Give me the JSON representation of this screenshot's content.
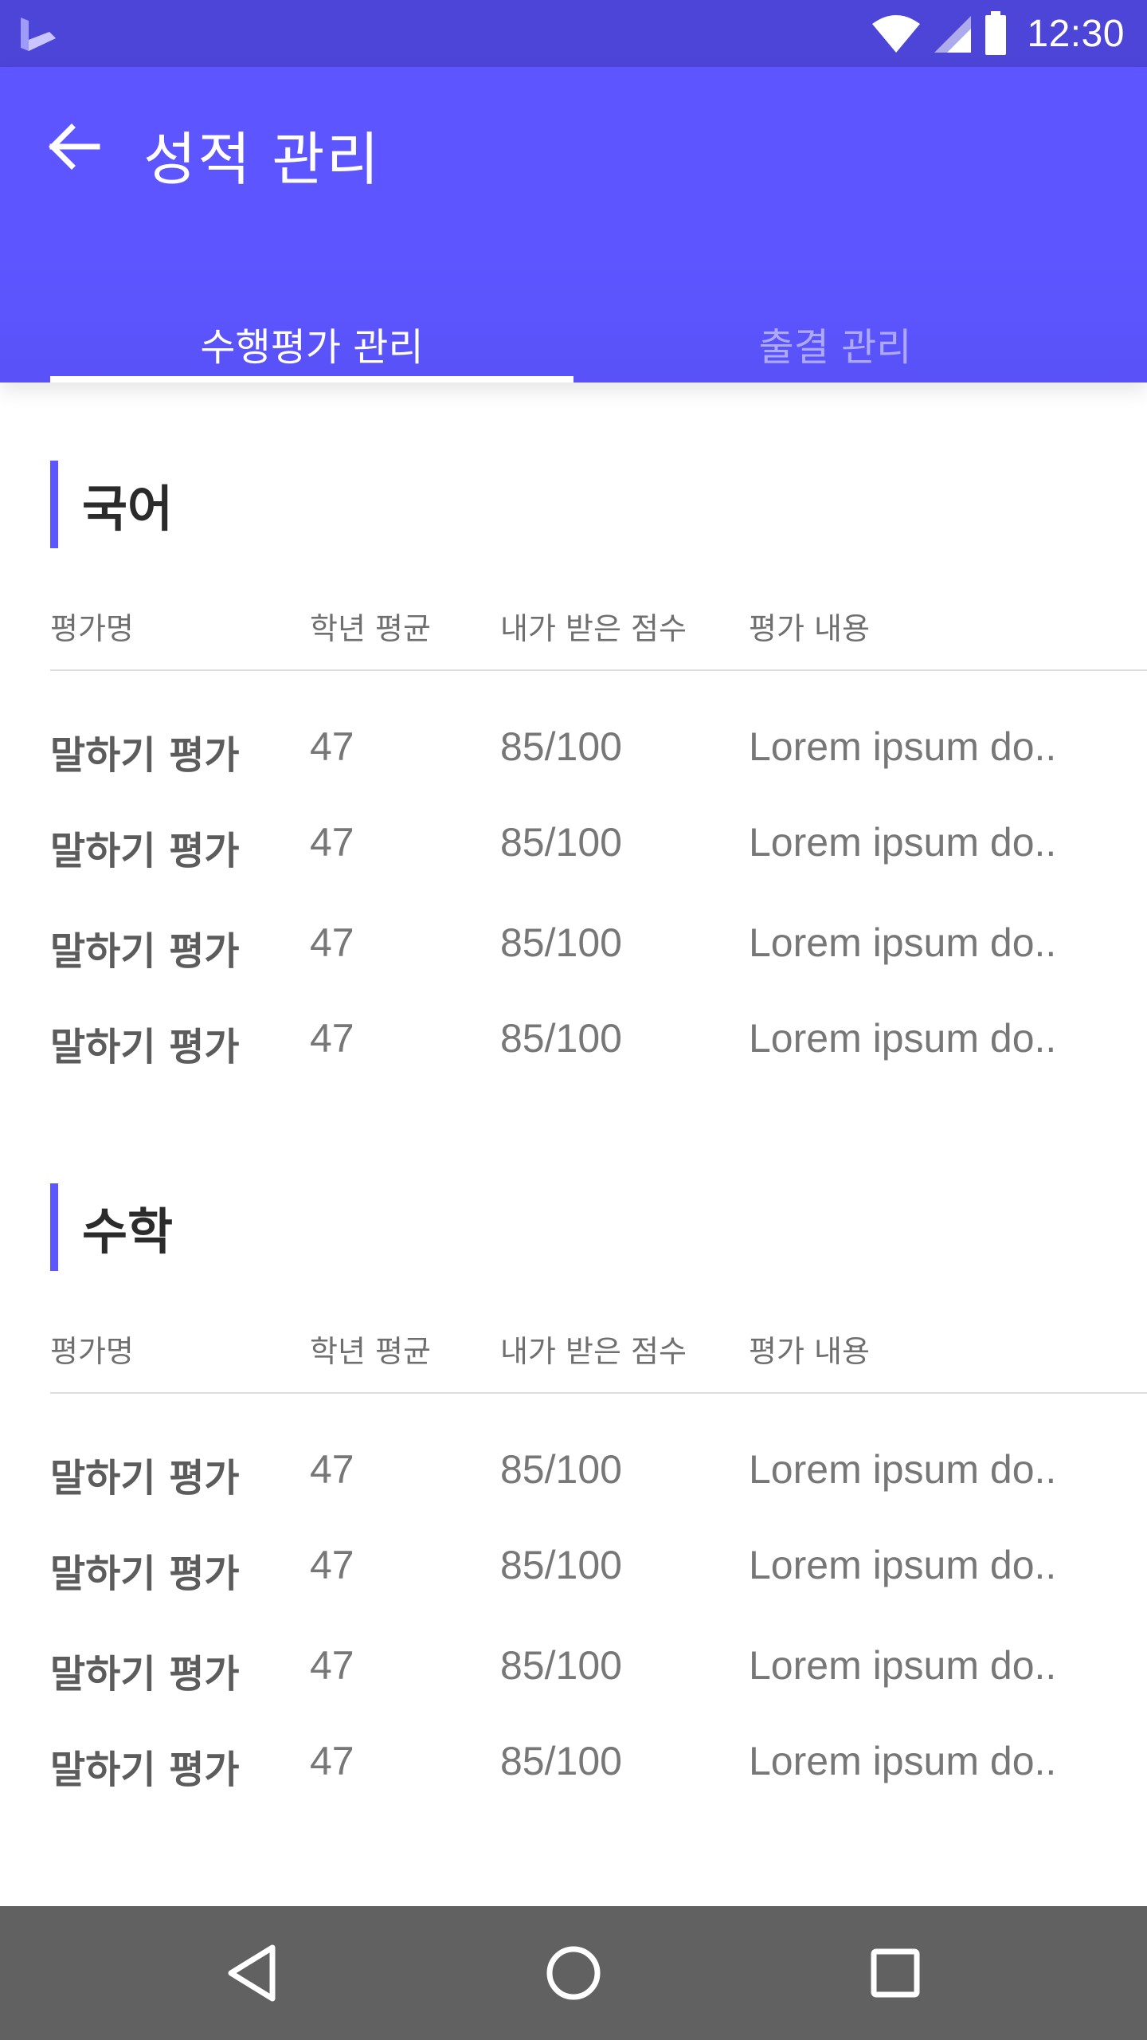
{
  "status_bar": {
    "time": "12:30",
    "icons": [
      "wifi-icon",
      "signal-icon",
      "battery-icon"
    ]
  },
  "app_bar": {
    "title": "성적 관리",
    "back_icon": "arrow-back-icon"
  },
  "tabs": [
    {
      "label": "수행평가 관리",
      "active": true
    },
    {
      "label": "출결 관리",
      "active": false
    }
  ],
  "columns": {
    "name": "평가명",
    "grade_avg": "학년 평균",
    "my_score": "내가 받은 점수",
    "content": "평가 내용"
  },
  "sections": [
    {
      "title": "국어",
      "rows": [
        {
          "name": "말하기 평가",
          "avg": "47",
          "score": "85/100",
          "content": "Lorem ipsum do.."
        },
        {
          "name": "말하기 평가",
          "avg": "47",
          "score": "85/100",
          "content": "Lorem ipsum do.."
        },
        {
          "name": "말하기 평가",
          "avg": "47",
          "score": "85/100",
          "content": "Lorem ipsum do.."
        },
        {
          "name": "말하기 평가",
          "avg": "47",
          "score": "85/100",
          "content": "Lorem ipsum do.."
        }
      ]
    },
    {
      "title": "수학",
      "rows": [
        {
          "name": "말하기 평가",
          "avg": "47",
          "score": "85/100",
          "content": "Lorem ipsum do.."
        },
        {
          "name": "말하기 평가",
          "avg": "47",
          "score": "85/100",
          "content": "Lorem ipsum do.."
        },
        {
          "name": "말하기 평가",
          "avg": "47",
          "score": "85/100",
          "content": "Lorem ipsum do.."
        },
        {
          "name": "말하기 평가",
          "avg": "47",
          "score": "85/100",
          "content": "Lorem ipsum do.."
        }
      ]
    }
  ],
  "nav_bar": {
    "icons": [
      "back-triangle-icon",
      "home-circle-icon",
      "recents-square-icon"
    ]
  },
  "colors": {
    "status_bar": "#4c45d8",
    "primary": "#5d55ff",
    "nav_bar": "#616161"
  }
}
